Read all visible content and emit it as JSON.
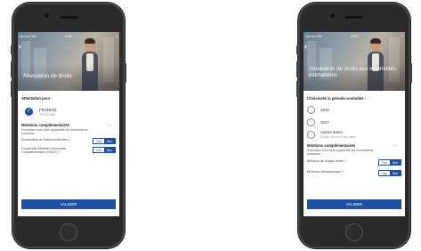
{
  "status_bar": {
    "carrier": "Aucune SIM",
    "time": "10:51",
    "battery": "▪▪"
  },
  "left_screen": {
    "title": "Attestation de droits",
    "section_label": "Attestation pour :",
    "person": {
      "name": "FRANCIS",
      "dob": "03/05/1954"
    },
    "mentions": {
      "title": "Mentions complémentaires",
      "subtitle": "Souhaitez-vous faire apparaître les informations suivantes :"
    },
    "toggles": [
      {
        "label": "Exonération du ticket modérateur ?",
        "oui": "Oui",
        "non": "Non",
        "selected": "Non"
      },
      {
        "label": "Couverture Maladie Universelle Complémentaire (CMUC) ?",
        "oui": "Oui",
        "non": "Non",
        "selected": "Non"
      }
    ],
    "validate": "VALIDER"
  },
  "right_screen": {
    "title": "Attestation de droits aux indemnités journalières",
    "section_label": "Choisissez la période souhaitée :",
    "radios": [
      {
        "label": "2018",
        "hint": ""
      },
      {
        "label": "2017",
        "hint": ""
      },
      {
        "label": "Autres dates",
        "hint": "Choisir librement des dates"
      }
    ],
    "mentions": {
      "title": "Mentions complémentaires",
      "subtitle": "Souhaitez-vous faire apparaître les informations suivantes :"
    },
    "toggles": [
      {
        "label": "Affection de longue durée ?",
        "oui": "Oui",
        "non": "Non",
        "selected": "Non"
      },
      {
        "label": "Mi-temps thérapeutique ?",
        "oui": "Oui",
        "non": "Non",
        "selected": "Non"
      }
    ],
    "validate": "VALIDER"
  },
  "colors": {
    "accent": "#1f4fa0",
    "device": "#2b2b2d"
  },
  "icons": [
    "back-chevron-icon",
    "check-icon",
    "chevron-down-icon"
  ]
}
